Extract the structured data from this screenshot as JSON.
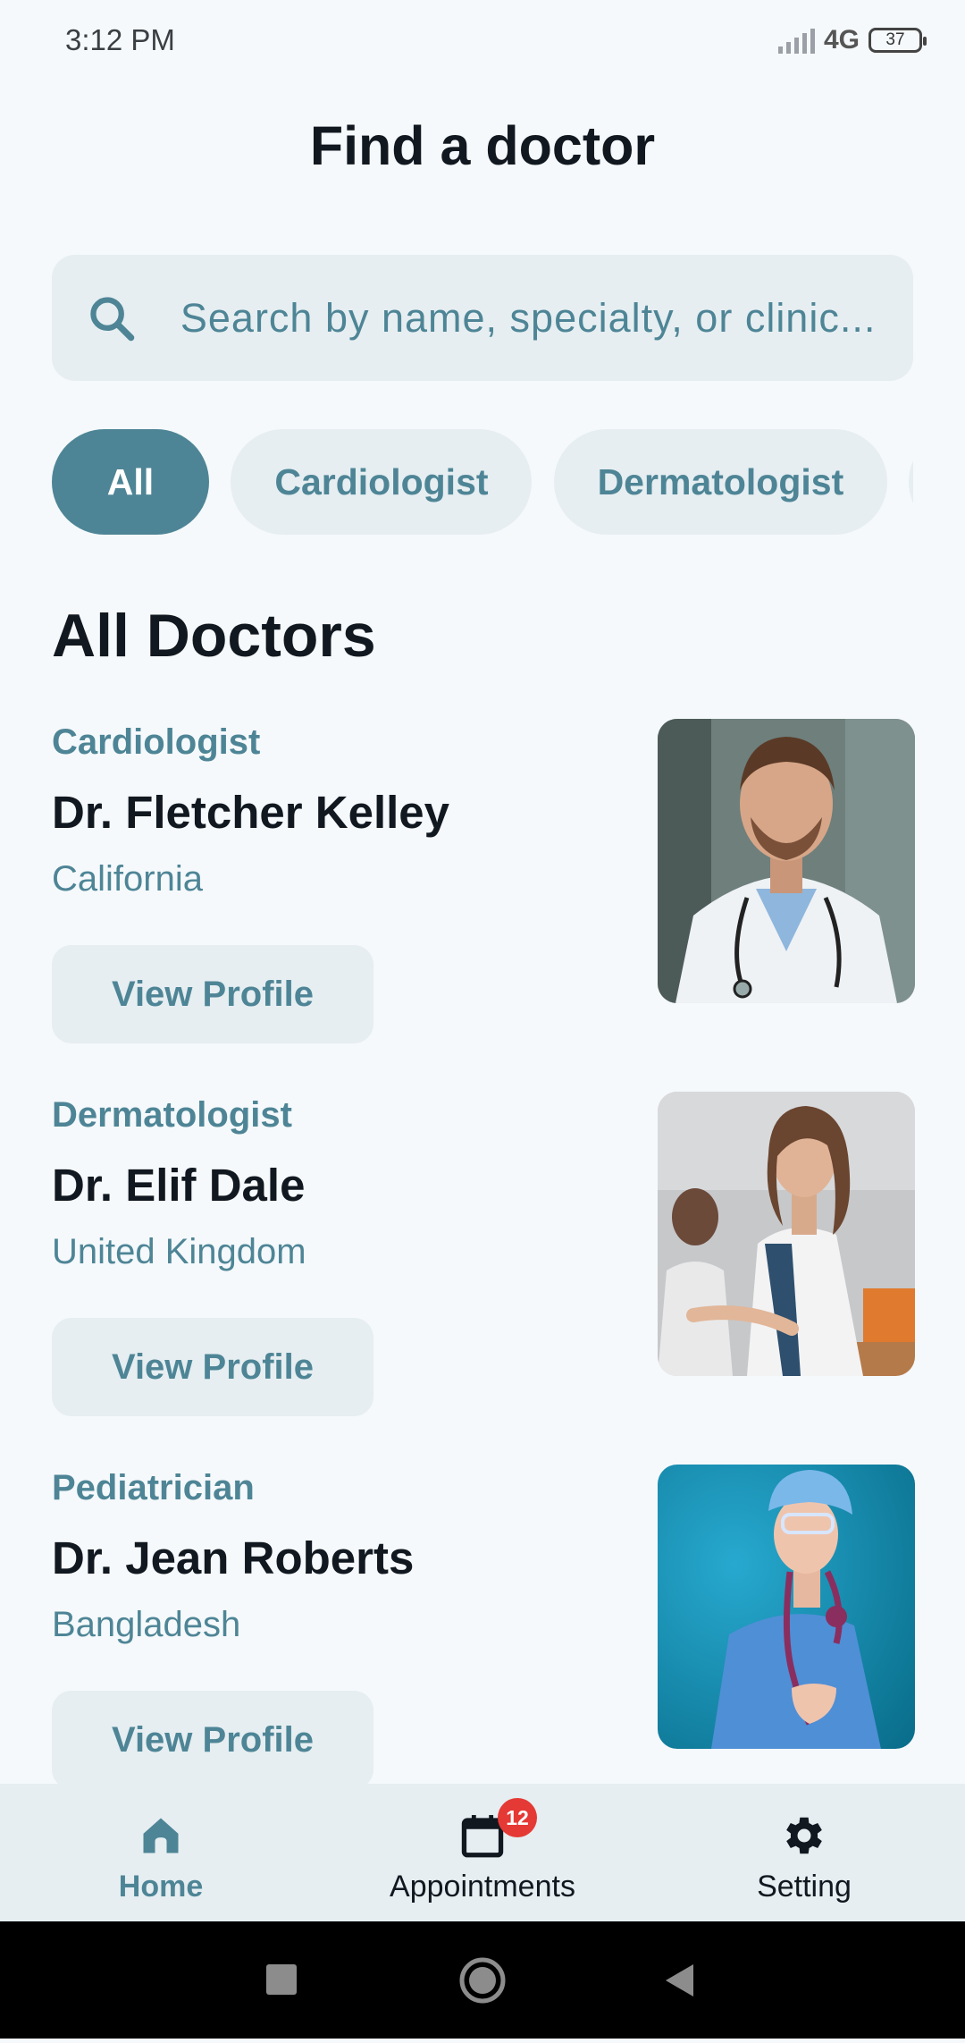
{
  "status": {
    "time": "3:12 PM",
    "network": "4G",
    "battery": "37"
  },
  "header": {
    "title": "Find a doctor"
  },
  "search": {
    "placeholder": "Search by name, specialty, or clinic..."
  },
  "filters": {
    "chips": [
      "All",
      "Cardiologist",
      "Dermatologist"
    ],
    "selected": "All"
  },
  "section": {
    "title": "All Doctors"
  },
  "doctors": [
    {
      "specialty": "Cardiologist",
      "name": "Dr. Fletcher Kelley",
      "location": "California",
      "button": "View Profile"
    },
    {
      "specialty": "Dermatologist",
      "name": "Dr. Elif Dale",
      "location": "United Kingdom",
      "button": "View Profile"
    },
    {
      "specialty": "Pediatrician",
      "name": "Dr. Jean Roberts",
      "location": "Bangladesh",
      "button": "View Profile"
    }
  ],
  "nav": {
    "items": [
      {
        "label": "Home",
        "icon": "home-icon",
        "active": true
      },
      {
        "label": "Appointments",
        "icon": "calendar-icon",
        "badge": "12"
      },
      {
        "label": "Setting",
        "icon": "gear-icon"
      }
    ]
  },
  "colors": {
    "accent": "#4e8596",
    "chip_bg": "#e6eef1",
    "background": "#f5f9fb",
    "badge": "#e53935"
  }
}
